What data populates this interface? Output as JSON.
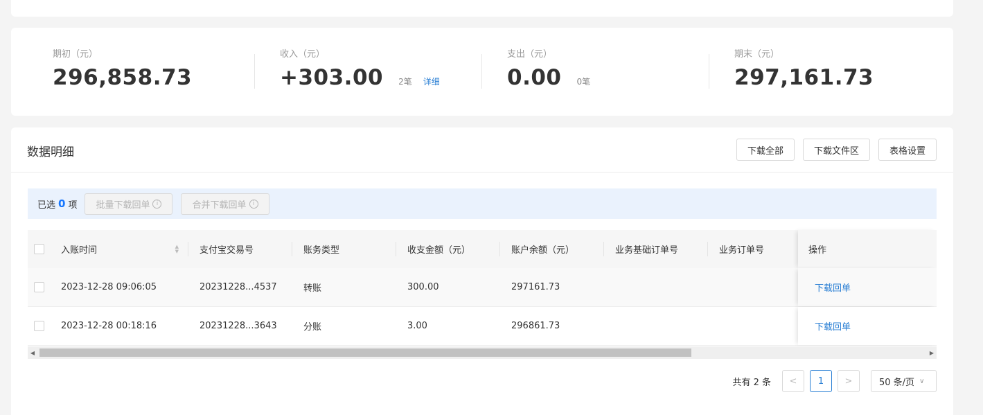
{
  "summary": {
    "opening": {
      "label": "期初（元）",
      "value": "296,858.73"
    },
    "income": {
      "label": "收入（元）",
      "value": "+303.00",
      "count": "2笔",
      "detail_link": "详细"
    },
    "expense": {
      "label": "支出（元）",
      "value": "0.00",
      "count": "0笔"
    },
    "closing": {
      "label": "期末（元）",
      "value": "297,161.73"
    }
  },
  "detail": {
    "title": "数据明细",
    "buttons": {
      "download_all": "下载全部",
      "download_files": "下载文件区",
      "table_settings": "表格设置"
    }
  },
  "selection": {
    "prefix": "已选",
    "count": "0",
    "suffix": "项",
    "batch_download": "批量下载回单",
    "merge_download": "合并下载回单"
  },
  "table": {
    "columns": [
      "入账时间",
      "支付宝交易号",
      "账务类型",
      "收支金额（元）",
      "账户余额（元）",
      "业务基础订单号",
      "业务订单号",
      "操作"
    ],
    "rows": [
      {
        "time": "2023-12-28 09:06:05",
        "trade_no": "20231228...4537",
        "type": "转账",
        "amount": "300.00",
        "balance": "297161.73",
        "base_order": "",
        "order": "",
        "action": "下载回单"
      },
      {
        "time": "2023-12-28 00:18:16",
        "trade_no": "20231228...3643",
        "type": "分账",
        "amount": "3.00",
        "balance": "296861.73",
        "base_order": "",
        "order": "",
        "action": "下载回单"
      }
    ]
  },
  "pagination": {
    "total": "共有 2 条",
    "current_page": "1",
    "page_size": "50 条/页"
  },
  "colors": {
    "link": "#2a7fd4",
    "selection_bar": "#eaf2fd",
    "selected_count": "#1677ff"
  }
}
